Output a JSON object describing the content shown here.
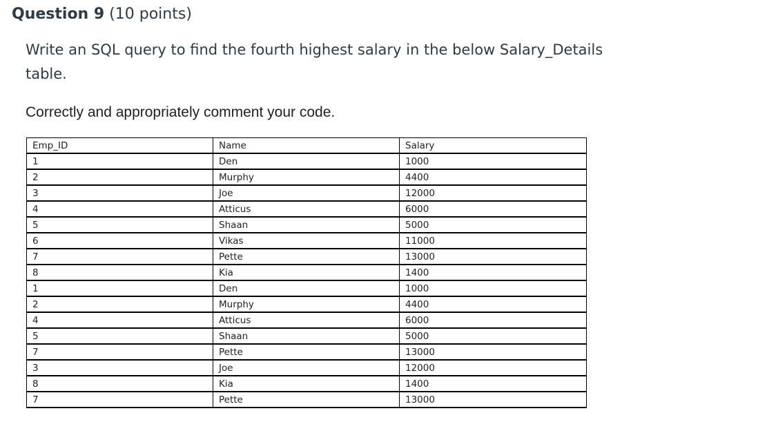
{
  "question": {
    "title": "Question 9",
    "points": " (10 points)"
  },
  "prompt": "Write an SQL query to find the fourth highest salary in the below  Salary_Details table.",
  "instruction": "Correctly and appropriately comment your code.",
  "table": {
    "headers": [
      "Emp_ID",
      "Name",
      "Salary"
    ],
    "rows": [
      [
        "1",
        "Den",
        "1000"
      ],
      [
        "2",
        "Murphy",
        "4400"
      ],
      [
        "3",
        "Joe",
        "12000"
      ],
      [
        "4",
        "Atticus",
        "6000"
      ],
      [
        "5",
        "Shaan",
        "5000"
      ],
      [
        "6",
        "Vikas",
        "11000"
      ],
      [
        "7",
        "Pette",
        "13000"
      ],
      [
        "8",
        "Kia",
        "1400"
      ],
      [
        "1",
        "Den",
        "1000"
      ],
      [
        "2",
        "Murphy",
        "4400"
      ],
      [
        "4",
        "Atticus",
        "6000"
      ],
      [
        "5",
        "Shaan",
        "5000"
      ],
      [
        "7",
        "Pette",
        "13000"
      ],
      [
        "3",
        "Joe",
        "12000"
      ],
      [
        "8",
        "Kia",
        "1400"
      ],
      [
        "7",
        "Pette",
        "13000"
      ]
    ]
  }
}
